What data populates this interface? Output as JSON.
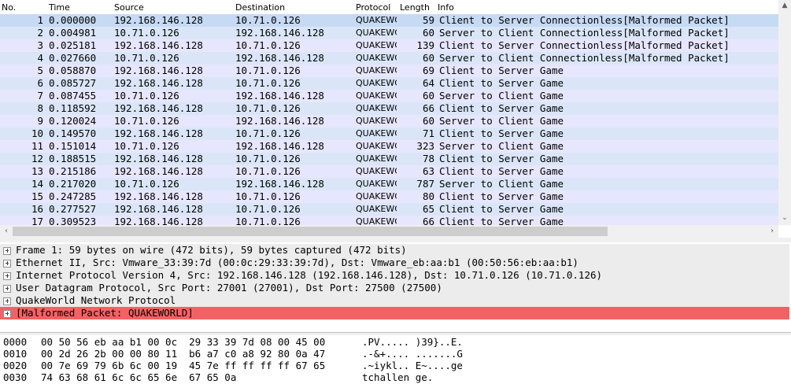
{
  "columns": {
    "no": "No.",
    "time": "Time",
    "source": "Source",
    "destination": "Destination",
    "protocol": "Protocol",
    "length": "Length",
    "info": "Info"
  },
  "packets": [
    {
      "no": "1",
      "time": "0.000000",
      "src": "192.168.146.128",
      "dst": "10.71.0.126",
      "proto": "QUAKEWC",
      "len": "59",
      "info": "Client to Server Connectionless[Malformed Packet]"
    },
    {
      "no": "2",
      "time": "0.004981",
      "src": "10.71.0.126",
      "dst": "192.168.146.128",
      "proto": "QUAKEWC",
      "len": "60",
      "info": "Server to Client Connectionless[Malformed Packet]"
    },
    {
      "no": "3",
      "time": "0.025181",
      "src": "192.168.146.128",
      "dst": "10.71.0.126",
      "proto": "QUAKEWC",
      "len": "139",
      "info": "Client to Server Connectionless[Malformed Packet]"
    },
    {
      "no": "4",
      "time": "0.027660",
      "src": "10.71.0.126",
      "dst": "192.168.146.128",
      "proto": "QUAKEWC",
      "len": "60",
      "info": "Server to Client Connectionless[Malformed Packet]"
    },
    {
      "no": "5",
      "time": "0.058870",
      "src": "192.168.146.128",
      "dst": "10.71.0.126",
      "proto": "QUAKEWC",
      "len": "69",
      "info": "Client to Server Game"
    },
    {
      "no": "6",
      "time": "0.085727",
      "src": "192.168.146.128",
      "dst": "10.71.0.126",
      "proto": "QUAKEWC",
      "len": "64",
      "info": "Client to Server Game"
    },
    {
      "no": "7",
      "time": "0.087455",
      "src": "10.71.0.126",
      "dst": "192.168.146.128",
      "proto": "QUAKEWC",
      "len": "60",
      "info": "Server to Client Game"
    },
    {
      "no": "8",
      "time": "0.118592",
      "src": "192.168.146.128",
      "dst": "10.71.0.126",
      "proto": "QUAKEWC",
      "len": "66",
      "info": "Client to Server Game"
    },
    {
      "no": "9",
      "time": "0.120024",
      "src": "10.71.0.126",
      "dst": "192.168.146.128",
      "proto": "QUAKEWC",
      "len": "60",
      "info": "Server to Client Game"
    },
    {
      "no": "10",
      "time": "0.149570",
      "src": "192.168.146.128",
      "dst": "10.71.0.126",
      "proto": "QUAKEWC",
      "len": "71",
      "info": "Client to Server Game"
    },
    {
      "no": "11",
      "time": "0.151014",
      "src": "10.71.0.126",
      "dst": "192.168.146.128",
      "proto": "QUAKEWC",
      "len": "323",
      "info": "Server to Client Game"
    },
    {
      "no": "12",
      "time": "0.188515",
      "src": "192.168.146.128",
      "dst": "10.71.0.126",
      "proto": "QUAKEWC",
      "len": "78",
      "info": "Client to Server Game"
    },
    {
      "no": "13",
      "time": "0.215186",
      "src": "192.168.146.128",
      "dst": "10.71.0.126",
      "proto": "QUAKEWC",
      "len": "63",
      "info": "Client to Server Game"
    },
    {
      "no": "14",
      "time": "0.217020",
      "src": "10.71.0.126",
      "dst": "192.168.146.128",
      "proto": "QUAKEWC",
      "len": "787",
      "info": "Server to Client Game"
    },
    {
      "no": "15",
      "time": "0.247285",
      "src": "192.168.146.128",
      "dst": "10.71.0.126",
      "proto": "QUAKEWC",
      "len": "80",
      "info": "Client to Server Game"
    },
    {
      "no": "16",
      "time": "0.277527",
      "src": "192.168.146.128",
      "dst": "10.71.0.126",
      "proto": "QUAKEWC",
      "len": "65",
      "info": "Client to Server Game"
    },
    {
      "no": "17",
      "time": "0.309523",
      "src": "192.168.146.128",
      "dst": "10.71.0.126",
      "proto": "QUAKEWC",
      "len": "66",
      "info": "Client to Server Game"
    }
  ],
  "details": [
    "Frame 1: 59 bytes on wire (472 bits), 59 bytes captured (472 bits)",
    "Ethernet II, Src: Vmware_33:39:7d (00:0c:29:33:39:7d), Dst: Vmware_eb:aa:b1 (00:50:56:eb:aa:b1)",
    "Internet Protocol Version 4, Src: 192.168.146.128 (192.168.146.128), Dst: 10.71.0.126 (10.71.0.126)",
    "User Datagram Protocol, Src Port: 27001 (27001), Dst Port: 27500 (27500)",
    "QuakeWorld Network Protocol",
    "[Malformed Packet: QUAKEWORLD]"
  ],
  "bytes": [
    {
      "offset": "0000",
      "hex": "00 50 56 eb aa b1 00 0c  29 33 39 7d 08 00 45 00",
      "ascii": ".PV..... )39}..E."
    },
    {
      "offset": "0010",
      "hex": "00 2d 26 2b 00 00 80 11  b6 a7 c0 a8 92 80 0a 47",
      "ascii": ".-&+.... .......G"
    },
    {
      "offset": "0020",
      "hex": "00 7e 69 79 6b 6c 00 19  45 7e ff ff ff ff 67 65",
      "ascii": ".~iykl.. E~....ge"
    },
    {
      "offset": "0030",
      "hex": "74 63 68 61 6c 6c 65 6e  67 65 0a",
      "ascii": "tchallen ge."
    }
  ],
  "colors": {
    "row_a": "#e7e6ff",
    "row_b": "#dae6f8",
    "malformed": "#f36262"
  },
  "icons": {
    "scroll_up": "chevron-up-icon",
    "scroll_down": "chevron-down-icon",
    "scroll_left": "chevron-left-icon",
    "scroll_right": "chevron-right-icon",
    "expand": "plus-box-icon"
  }
}
